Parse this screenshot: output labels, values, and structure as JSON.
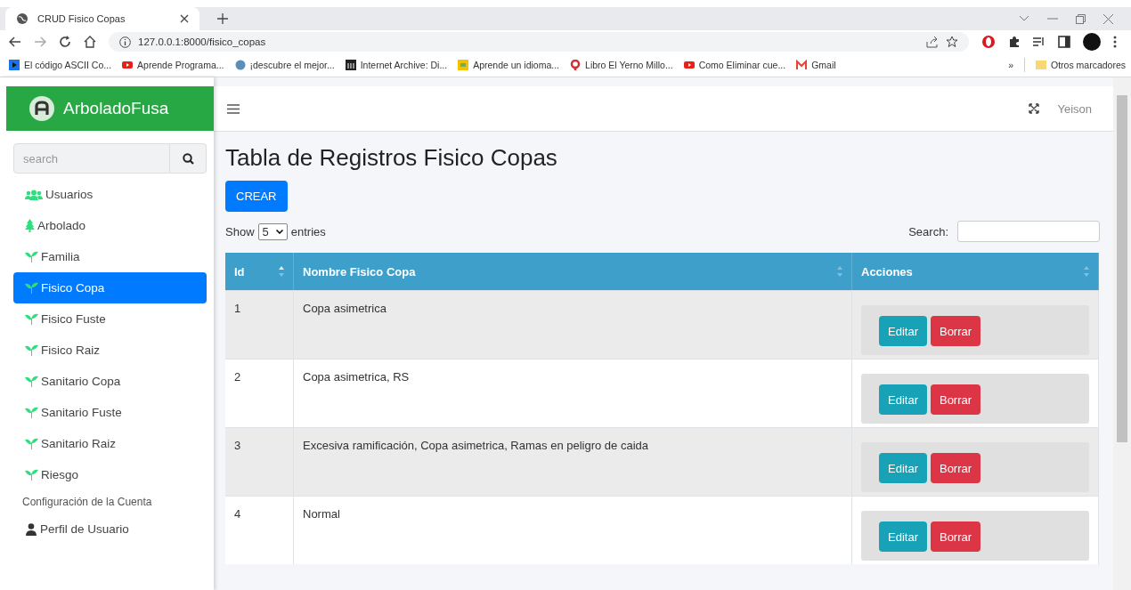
{
  "browser": {
    "tab_title": "CRUD Fisico Copas",
    "url": "127.0.0.1:8000/fisico_copas",
    "bookmarks": [
      {
        "label": "El código ASCII Co...",
        "kind": "play"
      },
      {
        "label": "Aprende Programa...",
        "kind": "video"
      },
      {
        "label": "¡descubre el mejor...",
        "kind": "globe"
      },
      {
        "label": "Internet Archive: Di...",
        "kind": "archive"
      },
      {
        "label": "Aprende un idioma...",
        "kind": "book"
      },
      {
        "label": "Libro El Yerno Millo...",
        "kind": "q"
      },
      {
        "label": "Como Eliminar cue...",
        "kind": "video"
      },
      {
        "label": "Gmail",
        "kind": "mail"
      }
    ],
    "more": "»",
    "other_bookmarks": "Otros marcadores"
  },
  "brand": "ArboladoFusa",
  "sidebar": {
    "search": {
      "placeholder": "search"
    },
    "items": [
      {
        "label": "Usuarios",
        "kind": "users",
        "selected": false
      },
      {
        "label": "Arbolado",
        "kind": "tree",
        "selected": false
      },
      {
        "label": "Familia",
        "kind": "sprout",
        "selected": false
      },
      {
        "label": "Fisico Copa",
        "kind": "sprout",
        "selected": true
      },
      {
        "label": "Fisico Fuste",
        "kind": "sprout",
        "selected": false
      },
      {
        "label": "Fisico Raiz",
        "kind": "sprout",
        "selected": false
      },
      {
        "label": "Sanitario Copa",
        "kind": "sprout",
        "selected": false
      },
      {
        "label": "Sanitario Fuste",
        "kind": "sprout",
        "selected": false
      },
      {
        "label": "Sanitario Raiz",
        "kind": "sprout",
        "selected": false
      },
      {
        "label": "Riesgo",
        "kind": "sprout",
        "selected": false
      }
    ],
    "section": "Configuración de la Cuenta",
    "profile": "Perfil de Usuario"
  },
  "topbar": {
    "user": "Yeison"
  },
  "page_title": "Tabla de Registros Fisico Copas",
  "create_button": "CREAR",
  "length": {
    "show": "Show",
    "value": "5",
    "entries": "entries"
  },
  "search_label": "Search:",
  "table": {
    "columns": [
      {
        "label": "Id",
        "sorted": true
      },
      {
        "label": "Nombre Fisico Copa",
        "sorted": false
      },
      {
        "label": "Acciones",
        "sorted": false
      }
    ],
    "rows": [
      {
        "id": "1",
        "name": "Copa asimetrica",
        "edit": "Editar",
        "delete": "Borrar"
      },
      {
        "id": "2",
        "name": "Copa asimetrica, RS",
        "edit": "Editar",
        "delete": "Borrar"
      },
      {
        "id": "3",
        "name": "Excesiva ramificación, Copa asimetrica, Ramas en peligro de caida",
        "edit": "Editar",
        "delete": "Borrar"
      },
      {
        "id": "4",
        "name": "Normal",
        "edit": "Editar",
        "delete": "Borrar"
      }
    ]
  }
}
